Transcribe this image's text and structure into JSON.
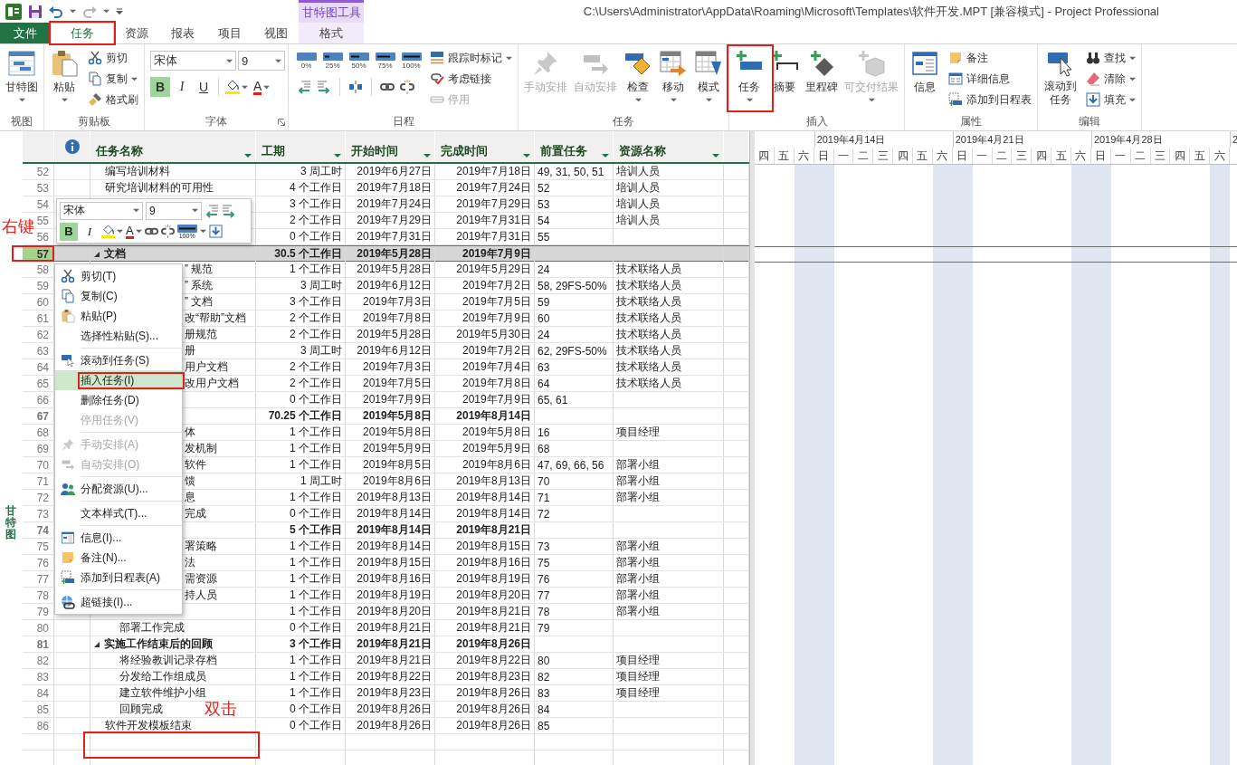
{
  "title_bar": {
    "contextual_header": "甘特图工具",
    "title": "C:\\Users\\Administrator\\AppData\\Roaming\\Microsoft\\Templates\\软件开发.MPT [兼容模式] - Project Professional"
  },
  "tabs": [
    {
      "label": "文件",
      "kind": "file",
      "selected": false
    },
    {
      "label": "任务",
      "kind": "tab",
      "selected": true
    },
    {
      "label": "资源",
      "kind": "tab",
      "selected": false
    },
    {
      "label": "报表",
      "kind": "tab",
      "selected": false
    },
    {
      "label": "项目",
      "kind": "tab",
      "selected": false
    },
    {
      "label": "视图",
      "kind": "tab",
      "selected": false
    },
    {
      "label": "格式",
      "kind": "contextual",
      "selected": false
    }
  ],
  "ribbon_groups": [
    {
      "label": "视图",
      "items": [
        {
          "kind": "large",
          "label": "甘特图",
          "dropdown": true,
          "disabled": false
        }
      ]
    },
    {
      "label": "剪贴板",
      "items": [
        {
          "kind": "large",
          "label": "粘贴",
          "dropdown": true,
          "disabled": false
        },
        {
          "kind": "stack",
          "items": [
            {
              "label": "剪切",
              "disabled": false
            },
            {
              "label": "复制",
              "dropdown": true,
              "disabled": false
            },
            {
              "label": "格式刷",
              "disabled": false
            }
          ]
        }
      ]
    },
    {
      "label": "字体",
      "items": [
        {
          "kind": "font",
          "font": "宋体",
          "size": "9",
          "styles": [
            {
              "label": "B",
              "on": true
            },
            {
              "label": "I",
              "on": false
            },
            {
              "label": "U",
              "on": false
            }
          ],
          "font_color": "A"
        }
      ]
    },
    {
      "label": "日程",
      "items": [
        {
          "kind": "schedule",
          "percents": [
            "0%",
            "25%",
            "50%",
            "75%",
            "100%"
          ]
        },
        {
          "kind": "stack",
          "items": [
            {
              "label": "跟踪时标记",
              "dropdown": true,
              "disabled": false
            },
            {
              "label": "考虑链接",
              "disabled": false
            },
            {
              "label": "停用",
              "disabled": true
            }
          ]
        }
      ]
    },
    {
      "label": "任务",
      "items": [
        {
          "kind": "large",
          "label": "手动安排",
          "disabled": true
        },
        {
          "kind": "large",
          "label": "自动安排",
          "disabled": true
        },
        {
          "kind": "large",
          "label": "检查",
          "dropdown": true,
          "disabled": false
        },
        {
          "kind": "large",
          "label": "移动",
          "dropdown": true,
          "disabled": false
        },
        {
          "kind": "large",
          "label": "模式",
          "dropdown": true,
          "disabled": false
        }
      ]
    },
    {
      "label": "插入",
      "items": [
        {
          "kind": "large",
          "label": "任务",
          "dropdown": true,
          "disabled": false
        },
        {
          "kind": "large",
          "label": "摘要",
          "disabled": false
        },
        {
          "kind": "large",
          "label": "里程碑",
          "disabled": false
        },
        {
          "kind": "large",
          "label": "可交付结果",
          "dropdown": true,
          "disabled": true
        }
      ]
    },
    {
      "label": "属性",
      "items": [
        {
          "kind": "large",
          "label": "信息",
          "disabled": false
        },
        {
          "kind": "stack",
          "items": [
            {
              "label": "备注",
              "disabled": false
            },
            {
              "label": "详细信息",
              "disabled": false
            },
            {
              "label": "添加到日程表",
              "disabled": false
            }
          ]
        }
      ]
    },
    {
      "label": "编辑",
      "items": [
        {
          "kind": "wrapped",
          "label": "滚动到任务",
          "disabled": false
        },
        {
          "kind": "stack",
          "items": [
            {
              "label": "查找",
              "dropdown": true,
              "disabled": false
            },
            {
              "label": "清除",
              "dropdown": true,
              "disabled": false
            },
            {
              "label": "填充",
              "dropdown": true,
              "disabled": false
            }
          ]
        }
      ]
    }
  ],
  "view_label": "甘特图",
  "columns": [
    {
      "label": "任务名称"
    },
    {
      "label": "工期"
    },
    {
      "label": "开始时间"
    },
    {
      "label": "完成时间"
    },
    {
      "label": "前置任务"
    },
    {
      "label": "资源名称"
    }
  ],
  "rows": [
    {
      "id": "52",
      "kind": "task",
      "name": "编写培训材料",
      "duration": "3 周工时",
      "start": "2019年6月27日",
      "finish": "2019年7月18日",
      "predecessors": "49, 31, 50, 51",
      "resource": "培训人员",
      "selected": false
    },
    {
      "id": "53",
      "kind": "task",
      "name": "研究培训材料的可用性",
      "duration": "4 个工作日",
      "start": "2019年7月18日",
      "finish": "2019年7月24日",
      "predecessors": "52",
      "resource": "培训人员",
      "selected": false
    },
    {
      "id": "54",
      "kind": "task",
      "duration": "3 个工作日",
      "start": "2019年7月24日",
      "finish": "2019年7月29日",
      "predecessors": "53",
      "resource": "培训人员",
      "selected": false
    },
    {
      "id": "55",
      "kind": "task",
      "duration": "2 个工作日",
      "start": "2019年7月29日",
      "finish": "2019年7月31日",
      "predecessors": "54",
      "resource": "培训人员",
      "selected": false
    },
    {
      "id": "56",
      "kind": "task",
      "duration": "0 个工作日",
      "start": "2019年7月31日",
      "finish": "2019年7月31日",
      "predecessors": "55",
      "selected": false
    },
    {
      "id": "57",
      "kind": "summary",
      "name": "文档",
      "expanded": true,
      "duration": "30.5 个工作日",
      "start": "2019年5月28日",
      "finish": "2019年7月9日",
      "selected": true,
      "children": [
        {
          "id": "58",
          "kind": "task",
          "name": "” 规范",
          "clipped": true,
          "duration": "1 个工作日",
          "start": "2019年5月28日",
          "finish": "2019年5月29日",
          "predecessors": "24",
          "resource": "技术联络人员",
          "selected": false
        },
        {
          "id": "59",
          "kind": "task",
          "name": "” 系统",
          "clipped": true,
          "duration": "3 周工时",
          "start": "2019年6月12日",
          "finish": "2019年7月2日",
          "predecessors": "58, 29FS-50%",
          "resource": "技术联络人员",
          "selected": false
        },
        {
          "id": "60",
          "kind": "task",
          "name": "” 文档",
          "clipped": true,
          "duration": "3 个工作日",
          "start": "2019年7月3日",
          "finish": "2019年7月5日",
          "predecessors": "59",
          "resource": "技术联络人员",
          "selected": false
        },
        {
          "id": "61",
          "kind": "task",
          "name": "改“帮助”文档",
          "clipped": true,
          "duration": "2 个工作日",
          "start": "2019年7月8日",
          "finish": "2019年7月9日",
          "predecessors": "60",
          "resource": "技术联络人员",
          "selected": false
        },
        {
          "id": "62",
          "kind": "task",
          "name": "册规范",
          "clipped": true,
          "duration": "2 个工作日",
          "start": "2019年5月28日",
          "finish": "2019年5月30日",
          "predecessors": "24",
          "resource": "技术联络人员",
          "selected": false
        },
        {
          "id": "63",
          "kind": "task",
          "name": "册",
          "clipped": true,
          "duration": "3 周工时",
          "start": "2019年6月12日",
          "finish": "2019年7月2日",
          "predecessors": "62, 29FS-50%",
          "resource": "技术联络人员",
          "selected": false
        },
        {
          "id": "64",
          "kind": "task",
          "name": "用户文档",
          "clipped": true,
          "duration": "2 个工作日",
          "start": "2019年7月3日",
          "finish": "2019年7月4日",
          "predecessors": "63",
          "resource": "技术联络人员",
          "selected": false
        },
        {
          "id": "65",
          "kind": "task",
          "name": "改用户文档",
          "clipped": true,
          "duration": "2 个工作日",
          "start": "2019年7月5日",
          "finish": "2019年7月8日",
          "predecessors": "64",
          "resource": "技术联络人员",
          "selected": false
        },
        {
          "id": "66",
          "kind": "task",
          "duration": "0 个工作日",
          "start": "2019年7月9日",
          "finish": "2019年7月9日",
          "predecessors": "65, 61",
          "selected": false
        }
      ]
    },
    {
      "id": "67",
      "kind": "summary",
      "duration": "70.25 个工作日",
      "start": "2019年5月8日",
      "finish": "2019年8月14日",
      "selected": false,
      "children": [
        {
          "id": "68",
          "kind": "task",
          "name": "体",
          "clipped": true,
          "duration": "1 个工作日",
          "start": "2019年5月8日",
          "finish": "2019年5月8日",
          "predecessors": "16",
          "resource": "项目经理",
          "selected": false
        },
        {
          "id": "69",
          "kind": "task",
          "name": "发机制",
          "clipped": true,
          "duration": "1 个工作日",
          "start": "2019年5月9日",
          "finish": "2019年5月9日",
          "predecessors": "68",
          "selected": false
        },
        {
          "id": "70",
          "kind": "task",
          "name": "软件",
          "clipped": true,
          "duration": "1 个工作日",
          "start": "2019年8月5日",
          "finish": "2019年8月6日",
          "predecessors": "47, 69, 66, 56",
          "resource": "部署小组",
          "selected": false
        },
        {
          "id": "71",
          "kind": "task",
          "name": "馈",
          "clipped": true,
          "duration": "1 周工时",
          "start": "2019年8月6日",
          "finish": "2019年8月13日",
          "predecessors": "70",
          "resource": "部署小组",
          "selected": false
        },
        {
          "id": "72",
          "kind": "task",
          "name": "息",
          "clipped": true,
          "duration": "1 个工作日",
          "start": "2019年8月13日",
          "finish": "2019年8月14日",
          "predecessors": "71",
          "resource": "部署小组",
          "selected": false
        },
        {
          "id": "73",
          "kind": "task",
          "name": "完成",
          "clipped": true,
          "duration": "0 个工作日",
          "start": "2019年8月14日",
          "finish": "2019年8月14日",
          "predecessors": "72",
          "selected": false
        }
      ]
    },
    {
      "id": "74",
      "kind": "summary",
      "duration": "5 个工作日",
      "start": "2019年8月14日",
      "finish": "2019年8月21日",
      "selected": false,
      "children": [
        {
          "id": "75",
          "kind": "task",
          "name": "署策略",
          "clipped": true,
          "duration": "1 个工作日",
          "start": "2019年8月14日",
          "finish": "2019年8月15日",
          "predecessors": "73",
          "resource": "部署小组",
          "selected": false
        },
        {
          "id": "76",
          "kind": "task",
          "name": "法",
          "clipped": true,
          "duration": "1 个工作日",
          "start": "2019年8月15日",
          "finish": "2019年8月16日",
          "predecessors": "75",
          "resource": "部署小组",
          "selected": false
        },
        {
          "id": "77",
          "kind": "task",
          "name": "需资源",
          "clipped": true,
          "duration": "1 个工作日",
          "start": "2019年8月16日",
          "finish": "2019年8月19日",
          "predecessors": "76",
          "resource": "部署小组",
          "selected": false
        },
        {
          "id": "78",
          "kind": "task",
          "name": "持人员",
          "clipped": true,
          "duration": "1 个工作日",
          "start": "2019年8月19日",
          "finish": "2019年8月20日",
          "predecessors": "77",
          "resource": "部署小组",
          "selected": false
        },
        {
          "id": "79",
          "kind": "task",
          "duration": "1 个工作日",
          "start": "2019年8月20日",
          "finish": "2019年8月21日",
          "predecessors": "78",
          "resource": "部署小组",
          "selected": false
        },
        {
          "id": "80",
          "kind": "task",
          "name": "部署工作完成",
          "duration": "0 个工作日",
          "start": "2019年8月21日",
          "finish": "2019年8月21日",
          "predecessors": "79",
          "selected": false
        }
      ]
    },
    {
      "id": "81",
      "kind": "summary",
      "name": "实施工作结束后的回顾",
      "expanded": true,
      "duration": "3 个工作日",
      "start": "2019年8月21日",
      "finish": "2019年8月26日",
      "selected": false,
      "children": [
        {
          "id": "82",
          "kind": "task",
          "name": "将经验教训记录存档",
          "duration": "1 个工作日",
          "start": "2019年8月21日",
          "finish": "2019年8月22日",
          "predecessors": "80",
          "resource": "项目经理",
          "selected": false
        },
        {
          "id": "83",
          "kind": "task",
          "name": "分发给工作组成员",
          "duration": "1 个工作日",
          "start": "2019年8月22日",
          "finish": "2019年8月23日",
          "predecessors": "82",
          "resource": "项目经理",
          "selected": false
        },
        {
          "id": "84",
          "kind": "task",
          "name": "建立软件维护小组",
          "duration": "1 个工作日",
          "start": "2019年8月23日",
          "finish": "2019年8月26日",
          "predecessors": "83",
          "resource": "项目经理",
          "selected": false
        },
        {
          "id": "85",
          "kind": "task",
          "name": "回顾完成",
          "duration": "0 个工作日",
          "start": "2019年8月26日",
          "finish": "2019年8月26日",
          "predecessors": "84",
          "selected": false
        }
      ]
    },
    {
      "id": "86",
      "kind": "task",
      "name": "软件开发模板结束",
      "duration": "0 个工作日",
      "start": "2019年8月26日",
      "finish": "2019年8月26日",
      "predecessors": "85",
      "selected": false
    }
  ],
  "gantt": {
    "weeks": [
      "2019年4月14日",
      "2019年4月21日",
      "2019年4月28日",
      "2"
    ],
    "days": [
      {
        "label": "四",
        "shaded": false
      },
      {
        "label": "五",
        "shaded": false
      },
      {
        "label": "六",
        "shaded": true
      },
      {
        "label": "日",
        "shaded": true
      },
      {
        "label": "一",
        "shaded": false
      },
      {
        "label": "二",
        "shaded": false
      },
      {
        "label": "三",
        "shaded": false
      },
      {
        "label": "四",
        "shaded": false
      },
      {
        "label": "五",
        "shaded": false
      },
      {
        "label": "六",
        "shaded": true
      },
      {
        "label": "日",
        "shaded": true
      },
      {
        "label": "一",
        "shaded": false
      },
      {
        "label": "二",
        "shaded": false
      },
      {
        "label": "三",
        "shaded": false
      },
      {
        "label": "四",
        "shaded": false
      },
      {
        "label": "五",
        "shaded": false
      },
      {
        "label": "六",
        "shaded": true
      },
      {
        "label": "日",
        "shaded": true
      },
      {
        "label": "一",
        "shaded": false
      },
      {
        "label": "二",
        "shaded": false
      },
      {
        "label": "三",
        "shaded": false
      },
      {
        "label": "四",
        "shaded": false
      },
      {
        "label": "五",
        "shaded": false
      },
      {
        "label": "六",
        "shaded": true
      }
    ]
  },
  "mini_toolbar": {
    "font": "宋体",
    "size": "9",
    "styles": [
      {
        "label": "B",
        "on": true
      },
      {
        "label": "I",
        "on": false
      }
    ],
    "font_color": "A",
    "percent": "100%"
  },
  "context_menu": [
    {
      "label": "剪切(T)",
      "selected": false,
      "disabled": false
    },
    {
      "label": "复制(C)",
      "selected": false,
      "disabled": false
    },
    {
      "label": "粘贴(P)",
      "selected": false,
      "disabled": false
    },
    {
      "label": "选择性粘贴(S)...",
      "selected": false,
      "disabled": false
    },
    {
      "kind": "separator"
    },
    {
      "label": "滚动到任务(S)",
      "selected": false,
      "disabled": false
    },
    {
      "label": "插入任务(I)",
      "selected": true,
      "disabled": false
    },
    {
      "label": "删除任务(D)",
      "selected": false,
      "disabled": false
    },
    {
      "label": "停用任务(V)",
      "selected": false,
      "disabled": true
    },
    {
      "kind": "separator"
    },
    {
      "label": "手动安排(A)",
      "selected": false,
      "disabled": true
    },
    {
      "label": "自动安排(O)",
      "selected": false,
      "disabled": true
    },
    {
      "kind": "separator"
    },
    {
      "label": "分配资源(U)...",
      "selected": false,
      "disabled": false
    },
    {
      "kind": "separator"
    },
    {
      "label": "文本样式(T)...",
      "selected": false,
      "disabled": false
    },
    {
      "kind": "separator"
    },
    {
      "label": "信息(I)...",
      "selected": false,
      "disabled": false
    },
    {
      "label": "备注(N)...",
      "selected": false,
      "disabled": false
    },
    {
      "label": "添加到日程表(A)",
      "selected": false,
      "disabled": false
    },
    {
      "kind": "separator"
    },
    {
      "label": "超链接(I)...",
      "selected": false,
      "disabled": false
    }
  ],
  "annotations": [
    {
      "kind": "box"
    },
    {
      "kind": "box"
    },
    {
      "kind": "box"
    },
    {
      "kind": "box"
    },
    {
      "kind": "box"
    },
    {
      "kind": "label",
      "text": "右键"
    },
    {
      "kind": "label",
      "text": "双击"
    }
  ]
}
